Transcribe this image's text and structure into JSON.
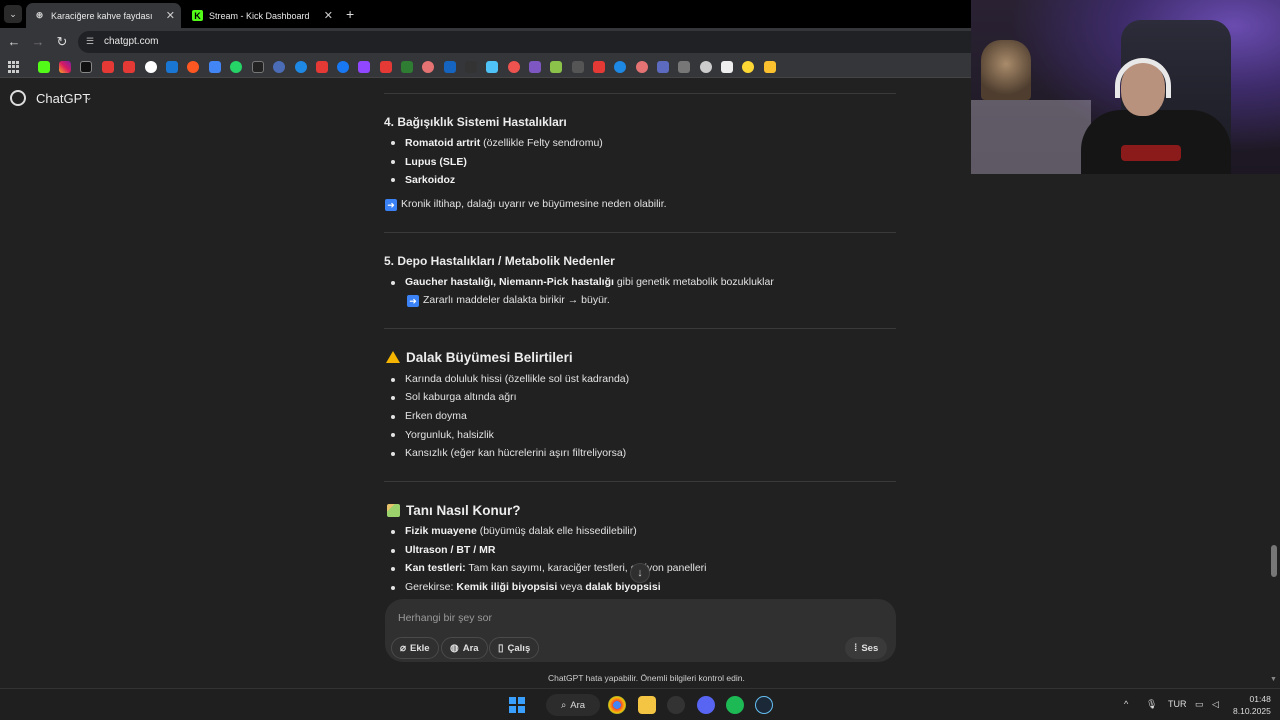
{
  "browser": {
    "tabs": [
      {
        "title": "Karaciğere kahve faydası",
        "active": true
      },
      {
        "title": "Stream - Kick Dashboard",
        "active": false
      }
    ],
    "url": "chatgpt.com"
  },
  "app": {
    "name": "ChatGPT"
  },
  "sections": {
    "s4": {
      "title": "4. Bağışıklık Sistemi Hastalıkları",
      "items": [
        {
          "bold": "Romatoid artrit",
          "rest": " (özellikle Felty sendromu)"
        },
        {
          "bold": "Lupus (SLE)",
          "rest": ""
        },
        {
          "bold": "Sarkoidoz",
          "rest": ""
        }
      ],
      "note": "Kronik iltihap, dalağı uyarır ve büyümesine neden olabilir."
    },
    "s5": {
      "title": "5. Depo Hastalıkları / Metabolik Nedenler",
      "item_bold": "Gaucher hastalığı, Niemann-Pick hastalığı",
      "item_rest": " gibi genetik metabolik bozukluklar",
      "note": "Zararlı maddeler dalakta birikir → büyür."
    },
    "symptoms": {
      "title": "Dalak Büyümesi Belirtileri",
      "items": [
        "Karında doluluk hissi (özellikle sol üst kadranda)",
        "Sol kaburga altında ağrı",
        "Erken doyma",
        "Yorgunluk, halsizlik",
        "Kansızlık (eğer kan hücrelerini aşırı filtreliyorsa)"
      ]
    },
    "diagnosis": {
      "title": "Tanı Nasıl Konur?",
      "items": [
        {
          "bold": "Fizik muayene",
          "rest": " (büyümüş dalak elle hissedilebilir)"
        },
        {
          "bold": "Ultrason / BT / MR",
          "rest": ""
        },
        {
          "bold": "Kan testleri:",
          "rest": " Tam kan sayımı, karaciğer testleri, e        siyon panelleri"
        }
      ],
      "last_prefix": "Gerekirse: ",
      "last_bold1": "Kemik iliği biyopsisi",
      "last_mid": " veya ",
      "last_bold2": "dalak biyopsisi"
    }
  },
  "composer": {
    "placeholder": "Herhangi bir şey sor",
    "btn_add": "Ekle",
    "btn_search": "Ara",
    "btn_study": "Çalış",
    "btn_voice": "Ses"
  },
  "disclaimer": "ChatGPT hata yapabilir. Önemli bilgileri kontrol edin.",
  "taskbar": {
    "search_label": "Ara",
    "lang": "TUR",
    "time": "01:48",
    "date": "8.10.2025"
  },
  "colors": {
    "page_bg": "#212121",
    "composer_bg": "#303030",
    "accent_blue": "#3b82f6",
    "warning": "#f4b400"
  }
}
